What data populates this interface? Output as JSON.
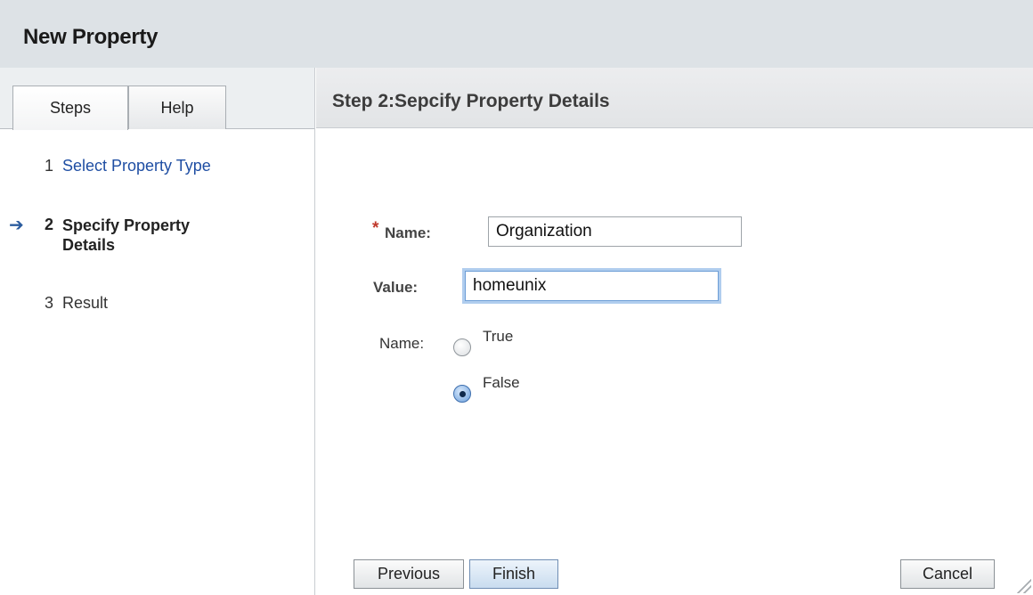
{
  "window": {
    "title": "New Property"
  },
  "tabs": [
    {
      "label": "Steps",
      "active": true
    },
    {
      "label": "Help",
      "active": false
    }
  ],
  "steps": [
    {
      "number": "1",
      "label": "Select Property Type",
      "state": "link"
    },
    {
      "number": "2",
      "label": "Specify Property Details",
      "state": "current"
    },
    {
      "number": "3",
      "label": "Result",
      "state": "pending"
    }
  ],
  "current_step_marker": "➔",
  "main": {
    "heading": "Step 2:Sepcify Property Details",
    "required_marker": "*",
    "name_label": "Name:",
    "name_value": "Organization",
    "value_label": "Value:",
    "value_value": "homeunix",
    "bool_label": "Name:",
    "options": [
      {
        "label": "True",
        "selected": false
      },
      {
        "label": "False",
        "selected": true
      }
    ]
  },
  "buttons": {
    "previous": "Previous",
    "finish": "Finish",
    "cancel": "Cancel"
  },
  "colors": {
    "title_bar_bg": "#dde2e6",
    "link": "#1f4ea3",
    "required": "#c0392b",
    "focus_ring": "#70a4e0"
  }
}
